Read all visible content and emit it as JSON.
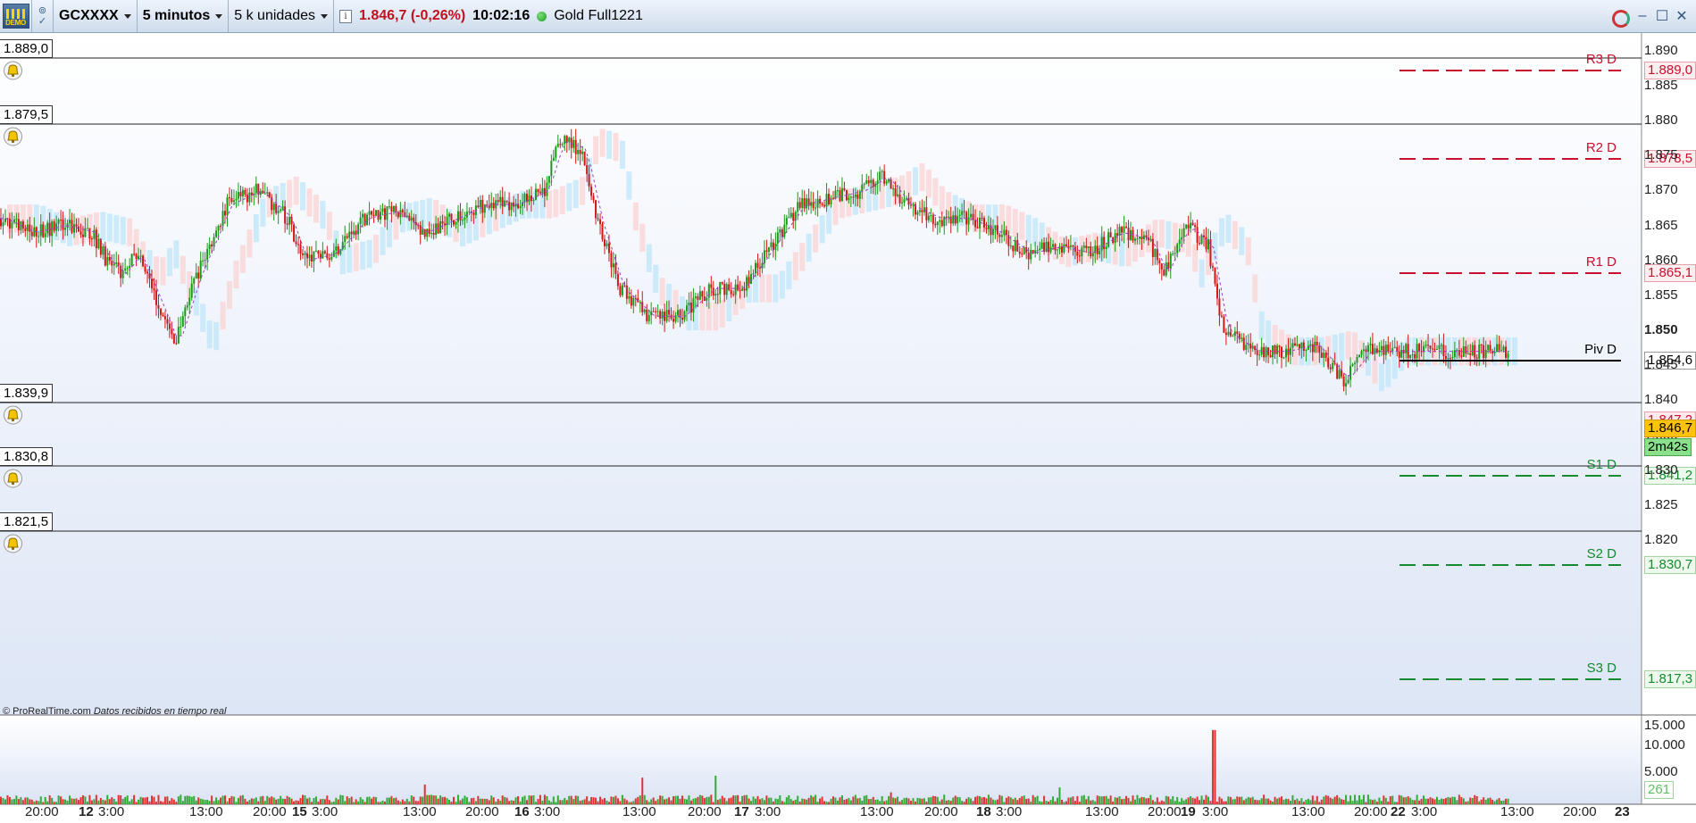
{
  "toolbar": {
    "demo_label": "DEMO",
    "ticker": "GCXXXX",
    "period": "5 minutos",
    "units": "5 k unidades",
    "last_price": "1.846,7 (-0,26%)",
    "clock": "10:02:16",
    "instrument": "Gold Full1221"
  },
  "chart": {
    "copyright": "© ProRealTime.com",
    "feed_note": "Datos recibidos en tiempo real",
    "alert_levels": [
      "1.889,0",
      "1.879,5",
      "1.839,9",
      "1.830,8",
      "1.821,5"
    ],
    "pivots": [
      {
        "name": "R3 D",
        "value": "1.889,0",
        "color": "#c8102e"
      },
      {
        "name": "R2 D",
        "value": "1.878,5",
        "color": "#c8102e"
      },
      {
        "name": "R1 D",
        "value": "1.865,1",
        "color": "#c8102e"
      },
      {
        "name": "Piv D",
        "value": "1.854,6",
        "color": "#000000"
      },
      {
        "name": "S1 D",
        "value": "1.841,2",
        "color": "#168a2e"
      },
      {
        "name": "S2 D",
        "value": "1.830,7",
        "color": "#168a2e"
      },
      {
        "name": "S3 D",
        "value": "1.817,3",
        "color": "#168a2e"
      }
    ],
    "price_ticks": [
      "1.890",
      "1.885",
      "1.880",
      "1.875",
      "1.870",
      "1.865",
      "1.860",
      "1.855",
      "1.850",
      "1.845",
      "1.840",
      "1.835",
      "1.830",
      "1.825",
      "1.820"
    ],
    "price_axis_bold": "1.850",
    "current_price": "1.846,7",
    "prev_price": "1.847,2",
    "countdown": "2m42s",
    "volume_ticks": [
      "15.000",
      "10.000",
      "5.000"
    ],
    "volume_current": "261",
    "time_labels": [
      {
        "t": "20:00",
        "day": false
      },
      {
        "t": "12",
        "day": true
      },
      {
        "t": "3:00",
        "day": false
      },
      {
        "t": "13:00",
        "day": false
      },
      {
        "t": "20:00",
        "day": false
      },
      {
        "t": "15",
        "day": true
      },
      {
        "t": "3:00",
        "day": false
      },
      {
        "t": "13:00",
        "day": false
      },
      {
        "t": "20:00",
        "day": false
      },
      {
        "t": "16",
        "day": true
      },
      {
        "t": "3:00",
        "day": false
      },
      {
        "t": "13:00",
        "day": false
      },
      {
        "t": "20:00",
        "day": false
      },
      {
        "t": "17",
        "day": true
      },
      {
        "t": "3:00",
        "day": false
      },
      {
        "t": "13:00",
        "day": false
      },
      {
        "t": "20:00",
        "day": false
      },
      {
        "t": "18",
        "day": true
      },
      {
        "t": "3:00",
        "day": false
      },
      {
        "t": "13:00",
        "day": false
      },
      {
        "t": "20:00",
        "day": false
      },
      {
        "t": "19",
        "day": true
      },
      {
        "t": "3:00",
        "day": false
      },
      {
        "t": "13:00",
        "day": false
      },
      {
        "t": "20:00",
        "day": false
      },
      {
        "t": "22",
        "day": true
      },
      {
        "t": "3:00",
        "day": false
      },
      {
        "t": "13:00",
        "day": false
      },
      {
        "t": "20:00",
        "day": false
      },
      {
        "t": "23",
        "day": true
      }
    ]
  },
  "chart_data": {
    "type": "candlestick",
    "symbol": "GCXXXX",
    "ylim": [
      1815,
      1892
    ],
    "price_path": [
      [
        0,
        1866
      ],
      [
        0.02,
        1864
      ],
      [
        0.04,
        1865
      ],
      [
        0.06,
        1864
      ],
      [
        0.07,
        1860
      ],
      [
        0.08,
        1858
      ],
      [
        0.09,
        1861
      ],
      [
        0.1,
        1856
      ],
      [
        0.115,
        1848
      ],
      [
        0.13,
        1858
      ],
      [
        0.15,
        1868
      ],
      [
        0.17,
        1870
      ],
      [
        0.19,
        1866
      ],
      [
        0.2,
        1860
      ],
      [
        0.22,
        1861
      ],
      [
        0.24,
        1866
      ],
      [
        0.26,
        1867
      ],
      [
        0.28,
        1864
      ],
      [
        0.3,
        1866
      ],
      [
        0.32,
        1868
      ],
      [
        0.34,
        1868
      ],
      [
        0.36,
        1870
      ],
      [
        0.37,
        1877
      ],
      [
        0.385,
        1876
      ],
      [
        0.395,
        1866
      ],
      [
        0.41,
        1856
      ],
      [
        0.43,
        1852
      ],
      [
        0.45,
        1852
      ],
      [
        0.47,
        1856
      ],
      [
        0.49,
        1856
      ],
      [
        0.51,
        1862
      ],
      [
        0.53,
        1868
      ],
      [
        0.55,
        1869
      ],
      [
        0.57,
        1870
      ],
      [
        0.585,
        1872
      ],
      [
        0.6,
        1868
      ],
      [
        0.62,
        1866
      ],
      [
        0.64,
        1866
      ],
      [
        0.66,
        1864
      ],
      [
        0.68,
        1861
      ],
      [
        0.7,
        1862
      ],
      [
        0.72,
        1861
      ],
      [
        0.74,
        1864
      ],
      [
        0.76,
        1863
      ],
      [
        0.77,
        1858
      ],
      [
        0.785,
        1865
      ],
      [
        0.8,
        1862
      ],
      [
        0.81,
        1850
      ],
      [
        0.83,
        1847
      ],
      [
        0.85,
        1847
      ],
      [
        0.87,
        1848
      ],
      [
        0.89,
        1843
      ],
      [
        0.905,
        1847
      ]
    ],
    "volume_max": 15000
  }
}
